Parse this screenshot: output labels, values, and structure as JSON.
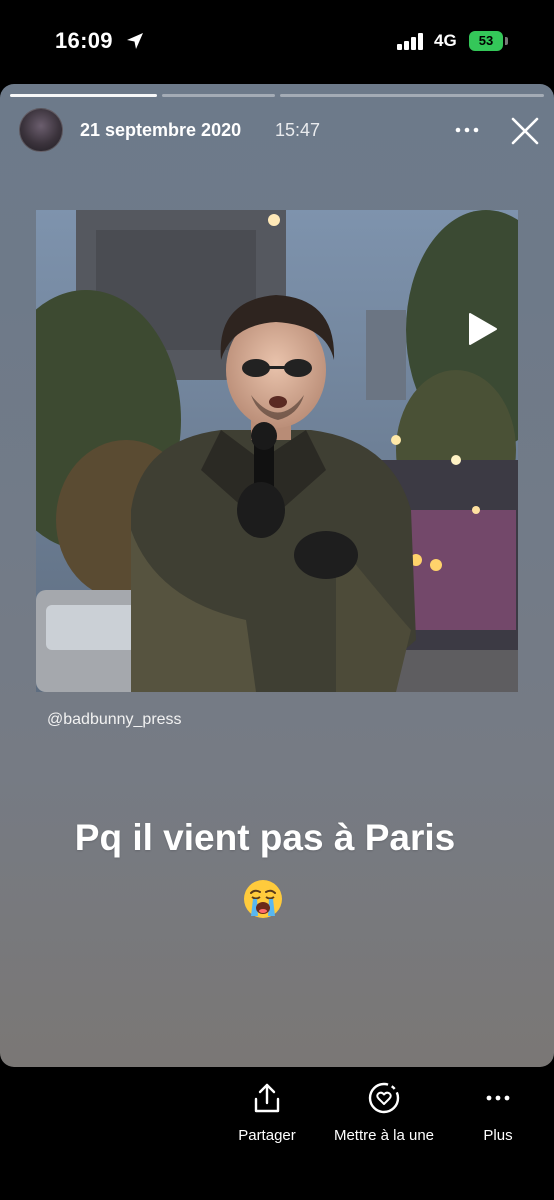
{
  "status_bar": {
    "time": "16:09",
    "network": "4G",
    "battery": "53"
  },
  "story": {
    "date": "21 septembre 2020",
    "time": "15:47",
    "caption": "@badbunny_press",
    "text": "Pq il vient pas à Paris",
    "emoji": "loudly-crying-face"
  },
  "toolbar": {
    "share_label": "Partager",
    "feature_label": "Mettre à la une",
    "more_label": "Plus"
  },
  "colors": {
    "battery": "#34c759",
    "story_top": "#6d7a8a",
    "story_bottom": "#7a7775"
  }
}
